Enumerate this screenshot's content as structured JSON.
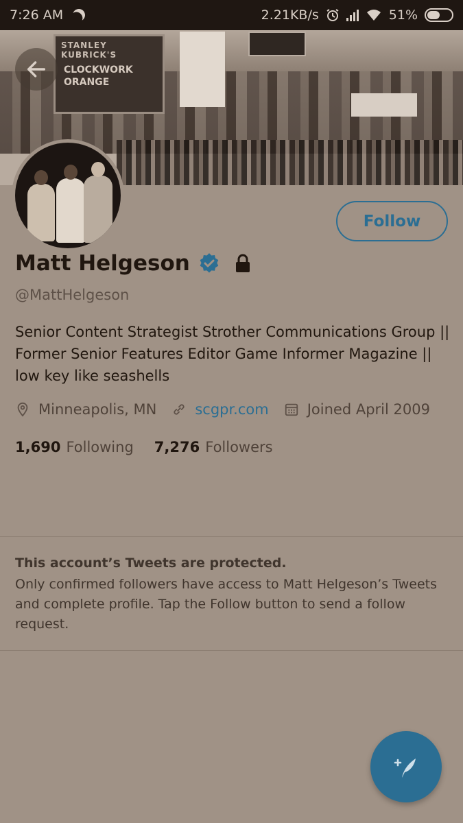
{
  "status_bar": {
    "time": "7:26 AM",
    "network_speed": "2.21KB/s",
    "battery": "51%",
    "icons": [
      "moon-icon",
      "alarm-icon",
      "signal-icon",
      "wifi-icon",
      "battery-icon"
    ]
  },
  "banner": {
    "sign_top": "STANLEY KUBRICK'S",
    "sign_main": "CLOCKWORK ORANGE"
  },
  "profile": {
    "name": "Matt Helgeson",
    "handle": "@MattHelgeson",
    "verified": true,
    "protected": true,
    "bio": "Senior Content Strategist Strother Communications Group || Former Senior Features Editor Game Informer Magazine || low key like seashells",
    "location": "Minneapolis, MN",
    "website": "scgpr.com",
    "joined": "Joined April 2009",
    "following_count": "1,690",
    "following_label": "Following",
    "followers_count": "7,276",
    "followers_label": "Followers"
  },
  "actions": {
    "follow_label": "Follow"
  },
  "protected_notice": {
    "title": "This account’s Tweets are protected.",
    "body": "Only confirmed followers have access to Matt Helgeson’s Tweets and complete profile. Tap the Follow button to send a follow request."
  },
  "colors": {
    "accent": "#2b6e93",
    "background": "#a09286",
    "status_bar": "#1f1712"
  }
}
